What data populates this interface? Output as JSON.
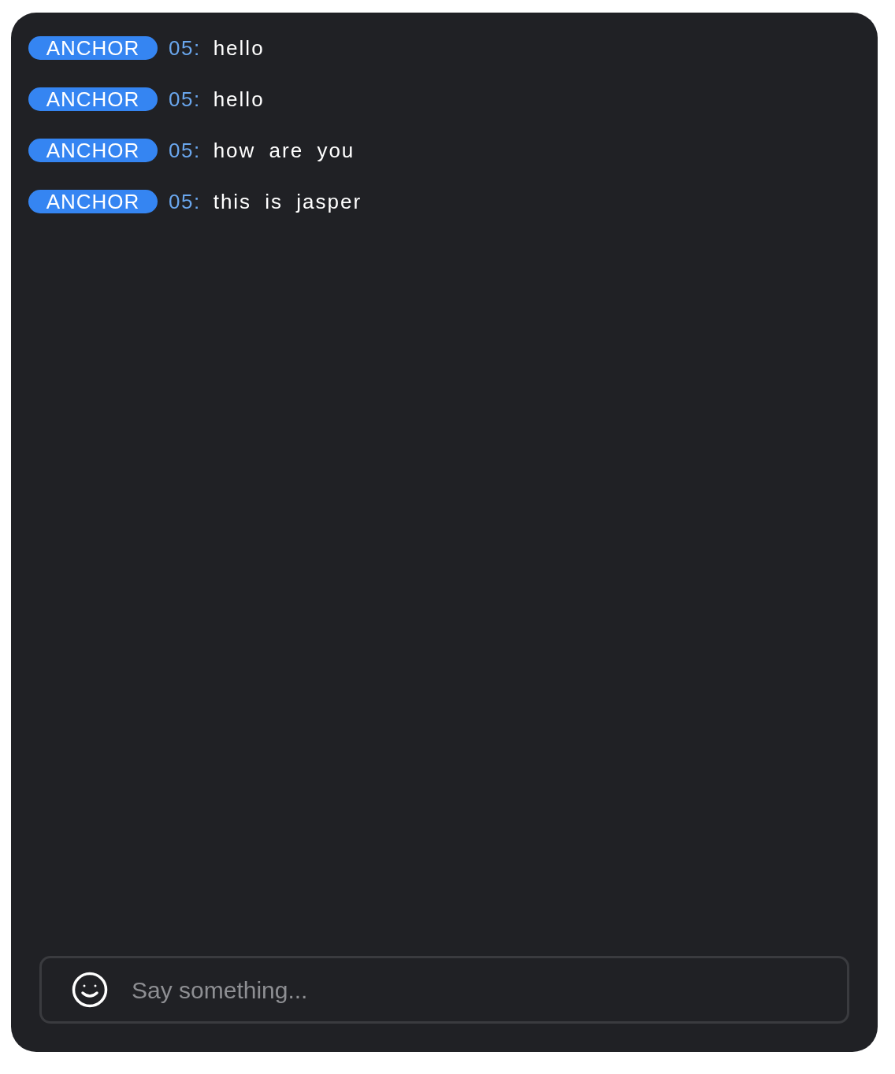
{
  "messages": [
    {
      "badge": "ANCHOR",
      "user": "05:",
      "text": "hello"
    },
    {
      "badge": "ANCHOR",
      "user": "05:",
      "text": "hello"
    },
    {
      "badge": "ANCHOR",
      "user": "05:",
      "text": "how are you"
    },
    {
      "badge": "ANCHOR",
      "user": "05:",
      "text": "this is jasper"
    }
  ],
  "composer": {
    "placeholder": "Say something..."
  }
}
